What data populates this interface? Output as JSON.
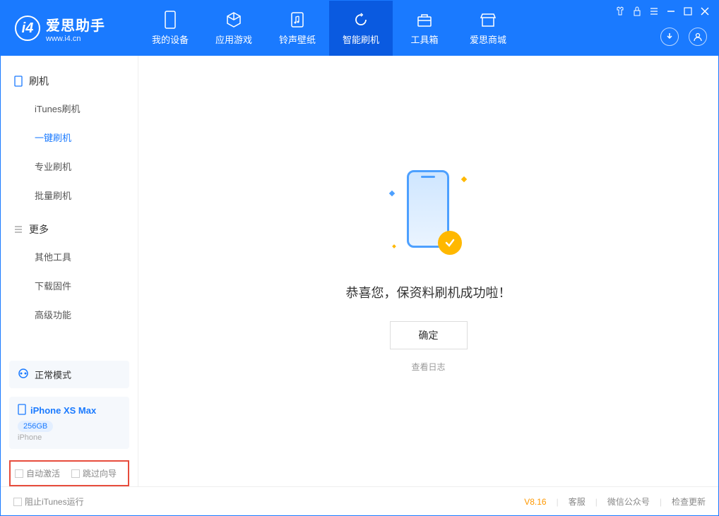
{
  "logo": {
    "title": "爱思助手",
    "sub": "www.i4.cn"
  },
  "nav": [
    {
      "label": "我的设备"
    },
    {
      "label": "应用游戏"
    },
    {
      "label": "铃声壁纸"
    },
    {
      "label": "智能刷机"
    },
    {
      "label": "工具箱"
    },
    {
      "label": "爱思商城"
    }
  ],
  "sidebar": {
    "section1_title": "刷机",
    "items1": [
      "iTunes刷机",
      "一键刷机",
      "专业刷机",
      "批量刷机"
    ],
    "section2_title": "更多",
    "items2": [
      "其他工具",
      "下载固件",
      "高级功能"
    ]
  },
  "mode_box": {
    "label": "正常模式"
  },
  "device_box": {
    "name": "iPhone XS Max",
    "storage": "256GB",
    "type": "iPhone"
  },
  "checkboxes": {
    "auto_activate": "自动激活",
    "skip_guide": "跳过向导"
  },
  "main": {
    "success_text": "恭喜您，保资料刷机成功啦！",
    "ok_button": "确定",
    "log_link": "查看日志"
  },
  "footer": {
    "block_itunes": "阻止iTunes运行",
    "version": "V8.16",
    "support": "客服",
    "wechat": "微信公众号",
    "update": "检查更新"
  }
}
